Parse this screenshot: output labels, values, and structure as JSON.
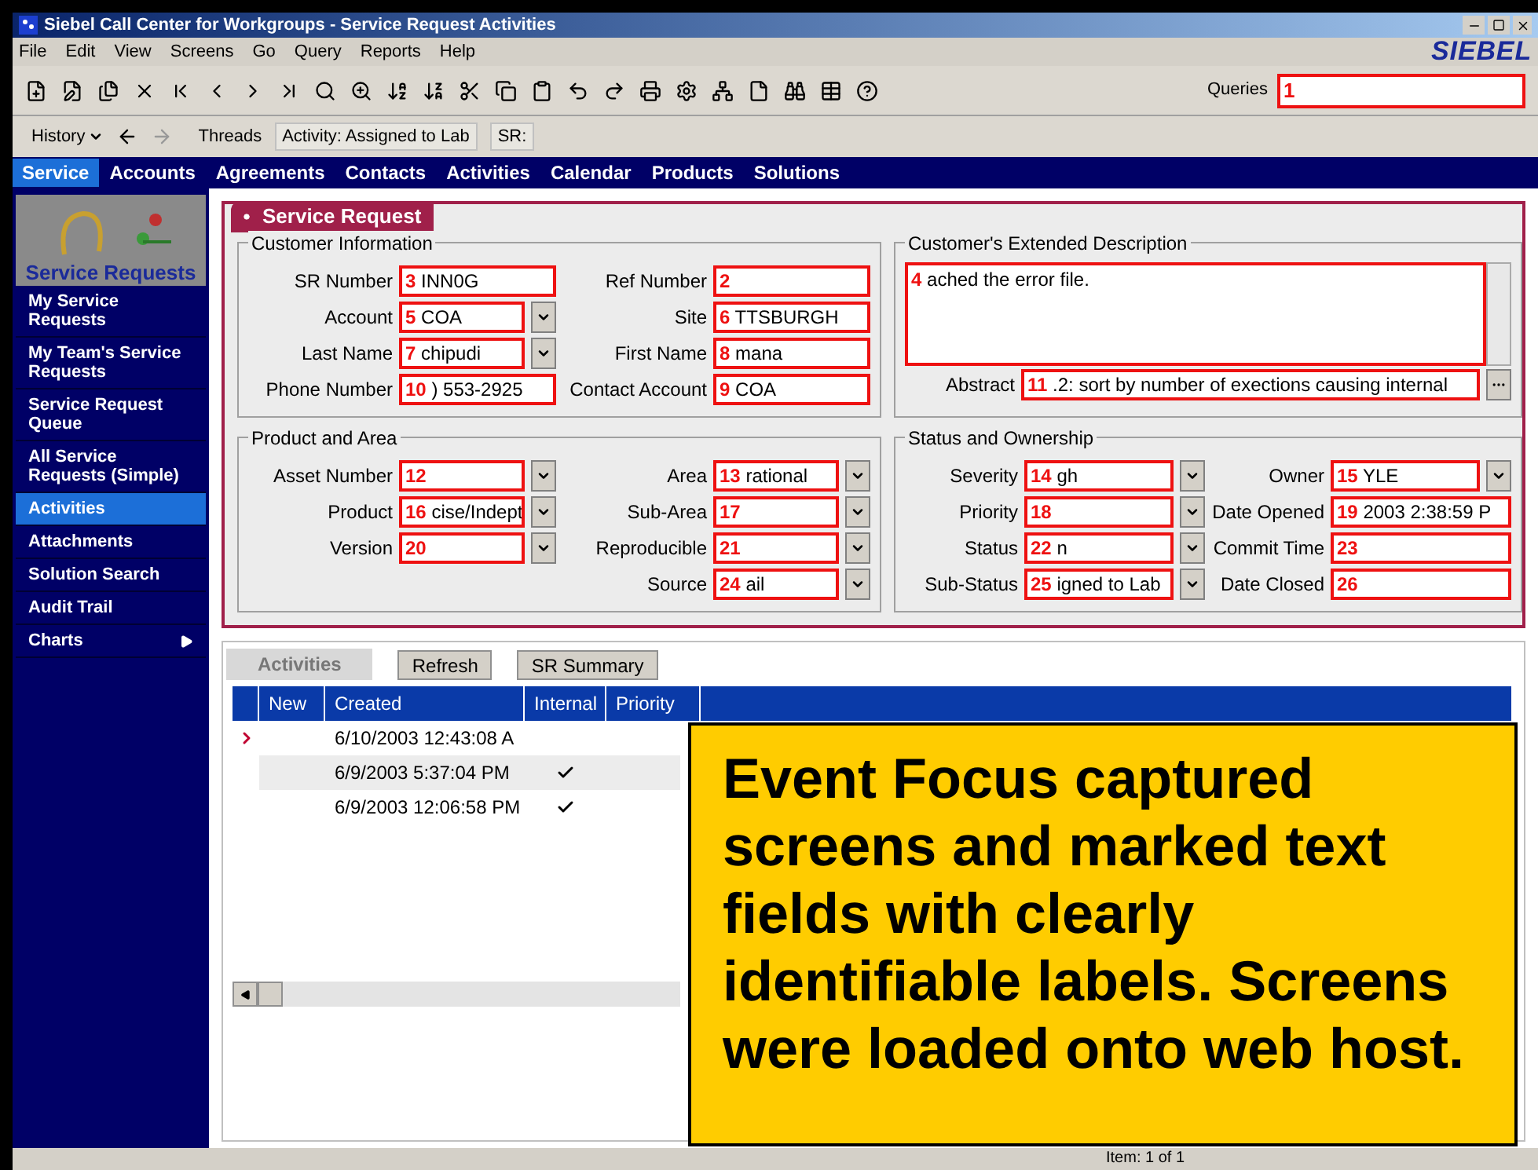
{
  "window": {
    "title": "Siebel Call Center for Workgroups - Service Request Activities"
  },
  "menu": [
    "File",
    "Edit",
    "View",
    "Screens",
    "Go",
    "Query",
    "Reports",
    "Help"
  ],
  "brand": "SIEBEL",
  "queries": {
    "label": "Queries",
    "marker": "1"
  },
  "history": {
    "label": "History"
  },
  "threads": {
    "label": "Threads",
    "items": [
      "Activity: Assigned to Lab",
      "SR:"
    ]
  },
  "nav_tabs": [
    {
      "label": "Service",
      "selected": true
    },
    {
      "label": "Accounts",
      "selected": false
    },
    {
      "label": "Agreements",
      "selected": false
    },
    {
      "label": "Contacts",
      "selected": false
    },
    {
      "label": "Activities",
      "selected": false
    },
    {
      "label": "Calendar",
      "selected": false
    },
    {
      "label": "Products",
      "selected": false
    },
    {
      "label": "Solutions",
      "selected": false
    }
  ],
  "sidebar": {
    "title": "Service Requests",
    "items": [
      {
        "label": "My Service Requests",
        "selected": false,
        "submenu": false
      },
      {
        "label": "My Team's Service Requests",
        "selected": false,
        "submenu": false
      },
      {
        "label": "Service Request Queue",
        "selected": false,
        "submenu": false
      },
      {
        "label": "All Service Requests (Simple)",
        "selected": false,
        "submenu": false
      },
      {
        "label": "Activities",
        "selected": true,
        "submenu": false
      },
      {
        "label": "Attachments",
        "selected": false,
        "submenu": false
      },
      {
        "label": "Solution Search",
        "selected": false,
        "submenu": false
      },
      {
        "label": "Audit Trail",
        "selected": false,
        "submenu": false
      },
      {
        "label": "Charts",
        "selected": false,
        "submenu": true
      }
    ]
  },
  "form": {
    "title": "Service Request",
    "sections": [
      {
        "title": "Customer Information",
        "columns": [
          [
            {
              "label": "SR Number",
              "marker": "3",
              "value": "INN0G",
              "kind": "text"
            },
            {
              "label": "Account",
              "marker": "5",
              "value": "COA",
              "kind": "dropdown"
            },
            {
              "label": "Last Name",
              "marker": "7",
              "value": "chipudi",
              "kind": "dropdown"
            },
            {
              "label": "Phone Number",
              "marker": "10",
              "value": ") 553-2925",
              "kind": "text"
            }
          ],
          [
            {
              "label": "Ref Number",
              "marker": "2",
              "kind": "text"
            },
            {
              "label": "Site",
              "marker": "6",
              "value": "TTSBURGH",
              "kind": "text"
            },
            {
              "label": "First Name",
              "marker": "8",
              "value": "mana",
              "kind": "text"
            },
            {
              "label": "Contact Account",
              "marker": "9",
              "value": "COA",
              "kind": "text"
            }
          ]
        ]
      },
      {
        "title": "Customer's Extended Description",
        "columns": [
          [
            {
              "marker": "4",
              "value": "ached the error file.",
              "kind": "textarea"
            },
            {
              "label": "Abstract",
              "marker": "11",
              "value": ".2:  sort by number of exections causing internal",
              "kind": "picker"
            }
          ]
        ]
      },
      {
        "title": "Product and Area",
        "columns": [
          [
            {
              "label": "Asset Number",
              "marker": "12",
              "kind": "dropdown"
            },
            {
              "label": "Product",
              "marker": "16",
              "value": "cise/Indept",
              "kind": "dropdown"
            },
            {
              "label": "Version",
              "marker": "20",
              "kind": "dropdown"
            }
          ],
          [
            {
              "label": "Area",
              "marker": "13",
              "value": "rational",
              "kind": "dropdown"
            },
            {
              "label": "Sub-Area",
              "marker": "17",
              "kind": "dropdown"
            },
            {
              "label": "Reproducible",
              "marker": "21",
              "kind": "dropdown"
            },
            {
              "label": "Source",
              "marker": "24",
              "value": "ail",
              "kind": "dropdown"
            }
          ]
        ]
      },
      {
        "title": "Status and Ownership",
        "columns": [
          [
            {
              "label": "Severity",
              "marker": "14",
              "value": "gh",
              "kind": "dropdown"
            },
            {
              "label": "Priority",
              "marker": "18",
              "kind": "dropdown"
            },
            {
              "label": "Status",
              "marker": "22",
              "value": "n",
              "kind": "dropdown"
            },
            {
              "label": "Sub-Status",
              "marker": "25",
              "value": "igned to Lab",
              "kind": "dropdown"
            }
          ],
          [
            {
              "label": "Owner",
              "marker": "15",
              "value": "YLE",
              "kind": "dropdown"
            },
            {
              "label": "Date Opened",
              "marker": "19",
              "value": "2003 2:38:59 P",
              "kind": "text"
            },
            {
              "label": "Commit Time",
              "marker": "23",
              "kind": "text"
            },
            {
              "label": "Date Closed",
              "marker": "26",
              "kind": "text"
            }
          ]
        ]
      }
    ]
  },
  "activities": {
    "tab": "Activities",
    "buttons": [
      "Refresh",
      "SR Summary"
    ],
    "columns": [
      "New",
      "Created",
      "Internal",
      "Priority"
    ],
    "rows": [
      {
        "current": true,
        "created": "6/10/2003 12:43:08 A",
        "internal": false
      },
      {
        "current": false,
        "created": "6/9/2003 5:37:04 PM",
        "internal": true
      },
      {
        "current": false,
        "created": "6/9/2003 12:06:58 PM",
        "internal": true
      }
    ]
  },
  "callout": {
    "text": "Event Focus captured screens and marked text fields with clearly identifiable labels. Screens were loaded onto web host."
  },
  "status_bar": {
    "text": "Item: 1 of 1"
  }
}
